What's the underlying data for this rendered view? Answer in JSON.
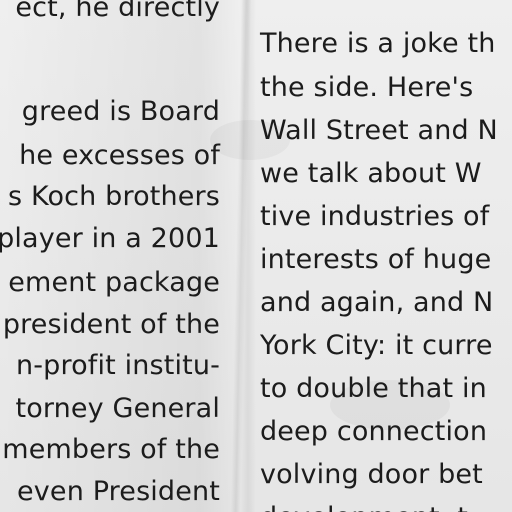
{
  "document": {
    "left_column": {
      "lines": [
        "ect, he directly",
        "greed is Board",
        "he excesses of",
        "s Koch brothers",
        "player in a 2001",
        "ement package",
        "president of the",
        "n-profit institu-",
        "torney General",
        "members of the",
        "even President"
      ]
    },
    "right_column": {
      "lines": [
        "There is a joke th",
        "the side. Here's",
        "Wall Street and N",
        "we talk about W",
        "tive industries of",
        "interests of huge",
        "and again, and N",
        "York City: it curre",
        "to double that in",
        "deep connection",
        "volving door bet",
        "development, t"
      ]
    }
  }
}
